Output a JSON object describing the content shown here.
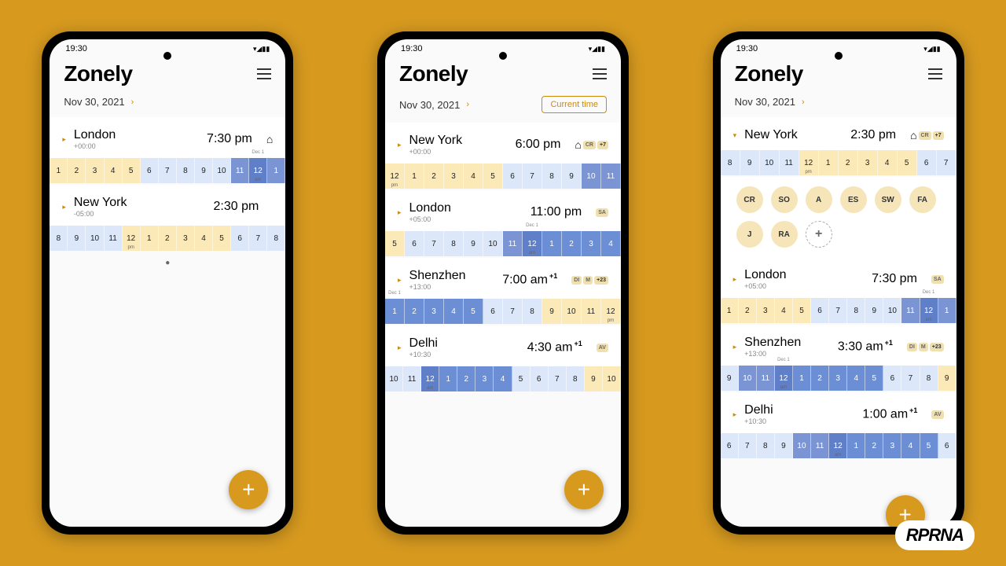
{
  "status": {
    "time": "19:30",
    "icons": "▾◢▮▮"
  },
  "app": {
    "title": "Zonely"
  },
  "date": "Nov 30, 2021",
  "current_time": "Current time",
  "watermark": "RPRNA",
  "fab": "+",
  "phone1": {
    "cities": [
      {
        "name": "London",
        "offset": "+00:00",
        "time": "7:30 pm",
        "home": true,
        "hours": [
          "1",
          "2",
          "3",
          "4",
          "5",
          "6",
          "7",
          "8",
          "9",
          "10",
          "11",
          "12",
          "1"
        ],
        "types": [
          "work",
          "work",
          "work",
          "work",
          "work",
          "",
          "",
          "",
          "",
          "",
          "night",
          "night-deep",
          "night"
        ],
        "labels": {
          "11": "am"
        },
        "date_label": {
          "11": "Dec 1"
        }
      },
      {
        "name": "New York",
        "offset": "-05:00",
        "time": "2:30 pm",
        "hours": [
          "8",
          "9",
          "10",
          "11",
          "12",
          "1",
          "2",
          "3",
          "4",
          "5",
          "6",
          "7",
          "8"
        ],
        "types": [
          "",
          "",
          "",
          "",
          "work",
          "work",
          "work",
          "work",
          "work",
          "work",
          "",
          "",
          ""
        ],
        "labels": {
          "4": "pm"
        }
      }
    ]
  },
  "phone2": {
    "cities": [
      {
        "name": "New York",
        "offset": "+00:00",
        "time": "6:00 pm",
        "home": true,
        "badges": [
          "CR",
          "+7"
        ],
        "hours": [
          "12",
          "1",
          "2",
          "3",
          "4",
          "5",
          "6",
          "7",
          "8",
          "9",
          "10",
          "11"
        ],
        "types": [
          "work",
          "work",
          "work",
          "work",
          "work",
          "work",
          "",
          "",
          "",
          "",
          "night",
          "night"
        ],
        "labels": {
          "0": "pm"
        }
      },
      {
        "name": "London",
        "offset": "+05:00",
        "time": "11:00 pm",
        "badges": [
          "SA"
        ],
        "hours": [
          "5",
          "6",
          "7",
          "8",
          "9",
          "10",
          "11",
          "12",
          "1",
          "2",
          "3",
          "4"
        ],
        "types": [
          "work",
          "",
          "",
          "",
          "",
          "",
          "night",
          "night-deep",
          "highlight",
          "highlight",
          "highlight",
          "highlight"
        ],
        "labels": {
          "7": "am"
        },
        "date_label": {
          "7": "Dec 1"
        }
      },
      {
        "name": "Shenzhen",
        "offset": "+13:00",
        "time": "7:00 am",
        "day_plus": "+1",
        "badges": [
          "DI",
          "M",
          "+23"
        ],
        "hours": [
          "1",
          "2",
          "3",
          "4",
          "5",
          "6",
          "7",
          "8",
          "9",
          "10",
          "11",
          "12"
        ],
        "types": [
          "highlight",
          "highlight",
          "highlight",
          "highlight",
          "highlight",
          "",
          "",
          "",
          "work",
          "work",
          "work",
          "work"
        ],
        "labels": {
          "11": "pm"
        },
        "date_label": {
          "0": "Dec 1"
        }
      },
      {
        "name": "Delhi",
        "offset": "+10:30",
        "time": "4:30 am",
        "day_plus": "+1",
        "badges": [
          "AV"
        ],
        "hours": [
          "10",
          "11",
          "12",
          "1",
          "2",
          "3",
          "4",
          "5",
          "6",
          "7",
          "8",
          "9",
          "10"
        ],
        "types": [
          "",
          "",
          "night-deep",
          "highlight",
          "highlight",
          "highlight",
          "highlight",
          "",
          "",
          "",
          "",
          "work",
          "work"
        ],
        "labels": {
          "2": "am"
        }
      }
    ]
  },
  "phone3": {
    "cities": [
      {
        "name": "New York",
        "offset": "",
        "time": "2:30 pm",
        "home": true,
        "badges": [
          "CR",
          "+7"
        ],
        "hours": [
          "8",
          "9",
          "10",
          "11",
          "12",
          "1",
          "2",
          "3",
          "4",
          "5",
          "6",
          "7"
        ],
        "types": [
          "",
          "",
          "",
          "",
          "work",
          "work",
          "work",
          "work",
          "work",
          "work",
          "",
          ""
        ],
        "labels": {
          "4": "pm"
        }
      },
      {
        "name": "London",
        "offset": "+05:00",
        "time": "7:30 pm",
        "badges": [
          "SA"
        ],
        "hours": [
          "1",
          "2",
          "3",
          "4",
          "5",
          "6",
          "7",
          "8",
          "9",
          "10",
          "11",
          "12",
          "1"
        ],
        "types": [
          "work",
          "work",
          "work",
          "work",
          "work",
          "",
          "",
          "",
          "",
          "",
          "night",
          "night-deep",
          "night"
        ],
        "labels": {
          "11": "am"
        },
        "date_label": {
          "11": "Dec 1"
        }
      },
      {
        "name": "Shenzhen",
        "offset": "+13:00",
        "time": "3:30 am",
        "day_plus": "+1",
        "badges": [
          "DI",
          "M",
          "+23"
        ],
        "hours": [
          "9",
          "10",
          "11",
          "12",
          "1",
          "2",
          "3",
          "4",
          "5",
          "6",
          "7",
          "8",
          "9"
        ],
        "types": [
          "",
          "night",
          "night",
          "night-deep",
          "highlight",
          "highlight",
          "highlight",
          "highlight",
          "highlight",
          "",
          "",
          "",
          "work"
        ],
        "labels": {
          "3": "am"
        },
        "date_label": {
          "3": "Dec 1"
        }
      },
      {
        "name": "Delhi",
        "offset": "+10:30",
        "time": "1:00 am",
        "day_plus": "+1",
        "badges": [
          "AV"
        ],
        "hours": [
          "6",
          "7",
          "8",
          "9",
          "10",
          "11",
          "12",
          "1",
          "2",
          "3",
          "4",
          "5",
          "6"
        ],
        "types": [
          "",
          "",
          "",
          "",
          "night",
          "night",
          "night-deep",
          "highlight",
          "highlight",
          "highlight",
          "highlight",
          "highlight",
          ""
        ],
        "labels": {
          "6": "am"
        }
      }
    ],
    "avatars": [
      "CR",
      "SO",
      "A",
      "ES",
      "SW",
      "FA",
      "J",
      "RA"
    ]
  }
}
